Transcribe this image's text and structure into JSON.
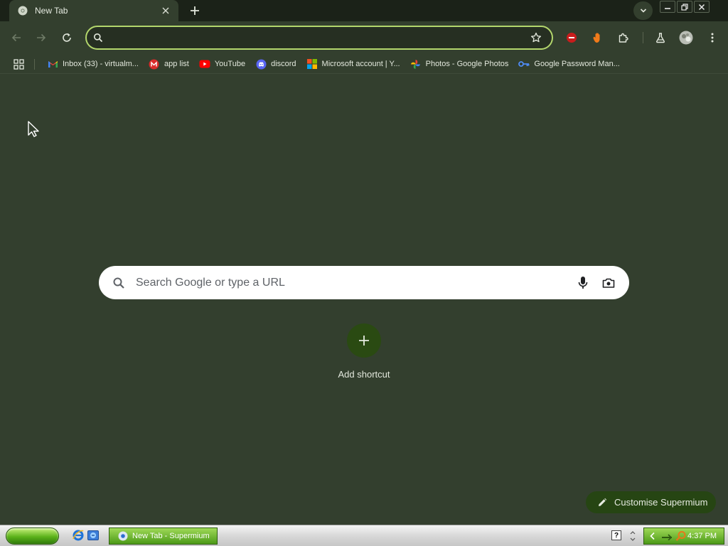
{
  "tab": {
    "title": "New Tab"
  },
  "omnibox": {
    "value": "",
    "placeholder": ""
  },
  "bookmarks": [
    {
      "label": "Inbox (33) - virtualm...",
      "icon": "gmail-icon"
    },
    {
      "label": "app list",
      "icon": "m-logo-icon"
    },
    {
      "label": "YouTube",
      "icon": "youtube-icon"
    },
    {
      "label": "discord",
      "icon": "discord-icon"
    },
    {
      "label": "Microsoft account | Y...",
      "icon": "microsoft-icon"
    },
    {
      "label": "Photos - Google Photos",
      "icon": "google-photos-icon"
    },
    {
      "label": "Google Password Man...",
      "icon": "key-icon"
    }
  ],
  "ntp": {
    "search_placeholder": "Search Google or type a URL",
    "add_shortcut_label": "Add shortcut",
    "customise_label": "Customise Supermium"
  },
  "taskbar": {
    "task_label": "New Tab - Supermium",
    "help_glyph": "?",
    "clock": "4:37 PM"
  },
  "colors": {
    "page_bg": "#333f2e",
    "omnibox_border": "#b3d66c",
    "accent_green": "#264513",
    "taskbar_green": "#4c9a18"
  }
}
